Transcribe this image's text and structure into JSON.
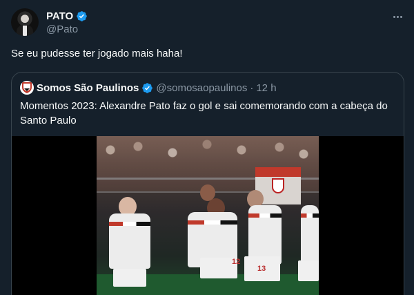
{
  "tweet": {
    "author_name": "PATO",
    "author_handle": "@Pato",
    "text": "Se eu pudesse ter jogado mais haha!",
    "verified_icon": "verified-badge-icon",
    "more_icon": "more-options-icon"
  },
  "quote": {
    "author_name": "Somos São Paulinos",
    "author_handle": "@somosaopaulinos",
    "separator": "·",
    "time": "12 h",
    "text": "Momentos 2023: Alexandre Pato faz o gol e sai comemorando com a cabeça do Santo Paulo",
    "jersey_number_left": "12",
    "jersey_number_right": "13"
  },
  "colors": {
    "background": "#15202b",
    "text": "#f7f9f9",
    "muted": "#8b98a5",
    "border": "#38444d",
    "verified": "#1d9bf0"
  }
}
